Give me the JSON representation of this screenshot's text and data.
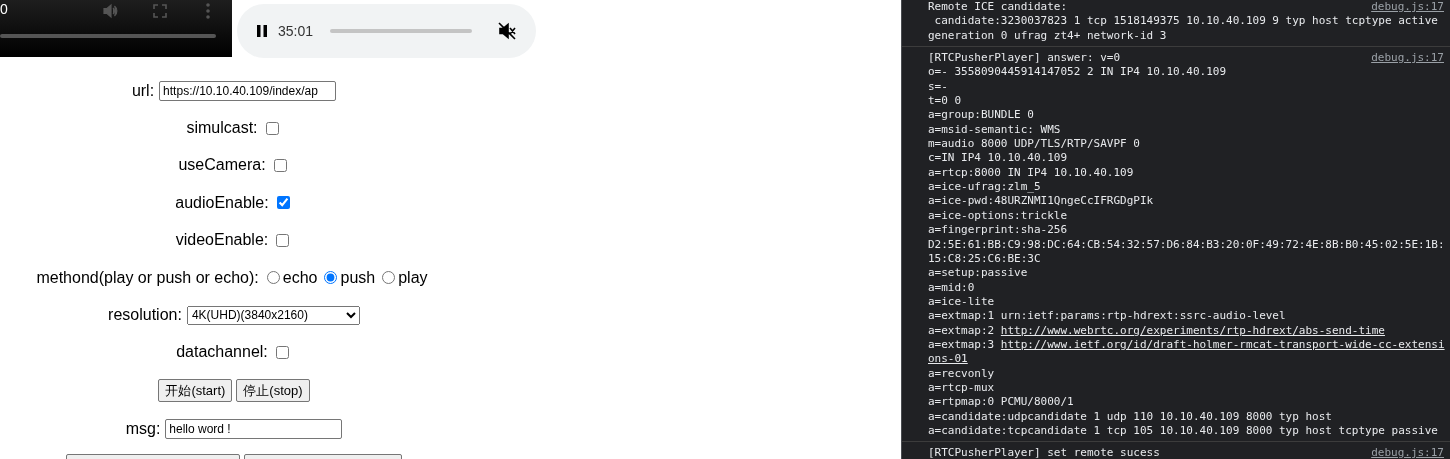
{
  "video": {
    "time": "0"
  },
  "audio": {
    "playing": true,
    "time": "35:01",
    "muted": true
  },
  "form": [
    {
      "kind": "text",
      "label": "url:",
      "value": "https://10.10.40.109/index/ap"
    },
    {
      "kind": "checkbox",
      "label": "simulcast:",
      "checked": false
    },
    {
      "kind": "checkbox",
      "label": "useCamera:",
      "checked": false
    },
    {
      "kind": "checkbox",
      "label": "audioEnable:",
      "checked": true
    },
    {
      "kind": "checkbox",
      "label": "videoEnable:",
      "checked": false
    },
    {
      "kind": "radio",
      "label": "methond(play or push or echo):",
      "options": [
        {
          "label": "echo",
          "selected": false
        },
        {
          "label": "push",
          "selected": true
        },
        {
          "label": "play",
          "selected": false
        }
      ]
    },
    {
      "kind": "select",
      "label": "resolution:",
      "value": "4K(UHD)(3840x2160)"
    },
    {
      "kind": "checkbox",
      "label": "datachannel:",
      "checked": false
    },
    {
      "kind": "buttons",
      "buttons": [
        "开始(start)",
        "停止(stop)"
      ]
    },
    {
      "kind": "text",
      "label": "msg:",
      "value": "hello word !"
    },
    {
      "kind": "blank-buttons",
      "buttons": [
        {
          "kind": "button"
        },
        {
          "kind": "button"
        }
      ]
    }
  ],
  "console": [
    {
      "source": "debug.js:17",
      "lines": [
        {
          "text": "Remote ICE candidate:"
        },
        {
          "text": " candidate:3230037823 1 tcp 1518149375 10.10.40.109 9 typ host tcptype active"
        },
        {
          "text": "generation 0 ufrag zt4+ network-id 3"
        }
      ]
    },
    {
      "source": "debug.js:17",
      "lines": [
        {
          "text": "[RTCPusherPlayer] answer: v=0"
        },
        {
          "text": "o=- 3558090445914147052 2 IN IP4 10.10.40.109"
        },
        {
          "text": "s=-"
        },
        {
          "text": "t=0 0"
        },
        {
          "text": "a=group:BUNDLE 0"
        },
        {
          "text": "a=msid-semantic: WMS"
        },
        {
          "text": "m=audio 8000 UDP/TLS/RTP/SAVPF 0"
        },
        {
          "text": "c=IN IP4 10.10.40.109"
        },
        {
          "text": "a=rtcp:8000 IN IP4 10.10.40.109"
        },
        {
          "text": "a=ice-ufrag:zlm_5"
        },
        {
          "text": "a=ice-pwd:48URZNMI1QngeCcIFRGDgPIk"
        },
        {
          "text": "a=ice-options:trickle"
        },
        {
          "text": "a=fingerprint:sha-256"
        },
        {
          "text": "D2:5E:61:BB:C9:98:DC:64:CB:54:32:57:D6:84:B3:20:0F:49:72:4E:8B:B0:45:02:5E:1B:"
        },
        {
          "text": "15:C8:25:C6:BE:3C"
        },
        {
          "text": "a=setup:passive"
        },
        {
          "text": "a=mid:0"
        },
        {
          "text": "a=ice-lite"
        },
        {
          "text": "a=extmap:1 urn:ietf:params:rtp-hdrext:ssrc-audio-level"
        },
        {
          "text": "a=extmap:2 ",
          "link": "http://www.webrtc.org/experiments/rtp-hdrext/abs-send-time"
        },
        {
          "text": "a=extmap:3 ",
          "link": "http://www.ietf.org/id/draft-holmer-rmcat-transport-wide-cc-extensi"
        },
        {
          "link": "ons-01"
        },
        {
          "text": "a=recvonly"
        },
        {
          "text": "a=rtcp-mux"
        },
        {
          "text": "a=rtpmap:0 PCMU/8000/1"
        },
        {
          "text": "a=candidate:udpcandidate 1 udp 110 10.10.40.109 8000 typ host"
        },
        {
          "text": "a=candidate:tcpcandidate 1 tcp 105 10.10.40.109 8000 typ host tcptype passive"
        }
      ]
    },
    {
      "source": "debug.js:17",
      "lines": [
        {
          "text": "[RTCPusherPlayer] set remote sucess"
        }
      ]
    }
  ]
}
